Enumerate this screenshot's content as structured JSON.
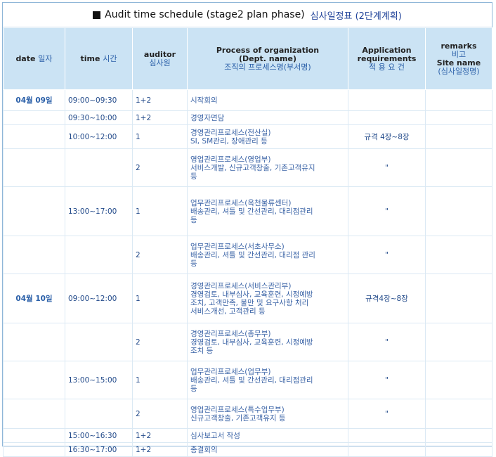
{
  "title": {
    "en": "Audit time schedule (stage2 plan phase)",
    "ko": "심사일정표 (2단계계획)"
  },
  "headers": {
    "date_en": "date",
    "date_ko": "일자",
    "time_en": "time",
    "time_ko": "시간",
    "auditor_en": "auditor",
    "auditor_ko": "심사원",
    "process_en1": "Process of organization",
    "process_en2": "(Dept. name)",
    "process_ko": "조직의 프로세스명(부서명)",
    "req_en1": "Application",
    "req_en2": "requirements",
    "req_ko": "적 용 요 건",
    "remarks_en": "remarks",
    "remarks_ko": "비고",
    "site_en": "Site name",
    "site_ko": "(심사일정명)"
  },
  "rows": [
    {
      "date": "04월 09일",
      "time": "09:00~09:30",
      "auditor": "1+2",
      "process": [
        "시작회의"
      ],
      "req": "",
      "remarks": ""
    },
    {
      "date": "",
      "time": "09:30~10:00",
      "auditor": "1+2",
      "process": [
        "경영자면담"
      ],
      "req": "",
      "remarks": ""
    },
    {
      "date": "",
      "time": "10:00~12:00",
      "auditor": "1",
      "process": [
        "경영관리프로세스(전산실)",
        "SI, SM관리, 장애관리 등"
      ],
      "req": "규격 4장~8장",
      "remarks": ""
    },
    {
      "date": "",
      "time": "",
      "auditor": "2",
      "process": [
        "영업관리프로세스(영업부)",
        "서비스개발, 신규고객창출, 기존고객유지",
        "등"
      ],
      "req": "\"",
      "remarks": ""
    },
    {
      "date": "",
      "time": "13:00~17:00",
      "auditor": "1",
      "process": [
        "업무관리프로세스(옥천물류센터)",
        "배송관리, 셔틀 및 간선관리, 대리점관리",
        "등"
      ],
      "req": "\"",
      "remarks": ""
    },
    {
      "date": "",
      "time": "",
      "auditor": "2",
      "process": [
        "업무관리프로세스(서초사무소)",
        "배송관리, 셔틀 및 간선관리, 대리점 관리",
        "등"
      ],
      "req": "\"",
      "remarks": ""
    },
    {
      "date": "04월 10일",
      "time": "09:00~12:00",
      "auditor": "1",
      "process": [
        "경영관리프로세스(서비스관리부)",
        "경영검토, 내부심사, 교육훈련, 시정예방",
        "조치, 고객만족, 불만 및 요구사항 처리",
        "서비스개선, 고객관리 등"
      ],
      "req": "규격4장~8장",
      "remarks": ""
    },
    {
      "date": "",
      "time": "",
      "auditor": "2",
      "process": [
        "경영관리프로세스(총무부)",
        "경영검토, 내부심사, 교육훈련, 시정예방",
        "조치 등"
      ],
      "req": "\"",
      "remarks": ""
    },
    {
      "date": "",
      "time": "13:00~15:00",
      "auditor": "1",
      "process": [
        "업무관리프로세스(업무부)",
        "배송관리, 셔틀 및 간선관리, 대리점관리",
        "등"
      ],
      "req": "\"",
      "remarks": ""
    },
    {
      "date": "",
      "time": "",
      "auditor": "2",
      "process": [
        "영업관리프로세스(특수업무부)",
        "신규고객창출, 기존고객유지 등"
      ],
      "req": "\"",
      "remarks": ""
    },
    {
      "date": "",
      "time": "15:00~16:30",
      "auditor": "1+2",
      "process": [
        "심사보고서 작성"
      ],
      "req": "",
      "remarks": ""
    },
    {
      "date": "",
      "time": "16:30~17:00",
      "auditor": "1+2",
      "process": [
        "종결회의"
      ],
      "req": "",
      "remarks": ""
    }
  ]
}
